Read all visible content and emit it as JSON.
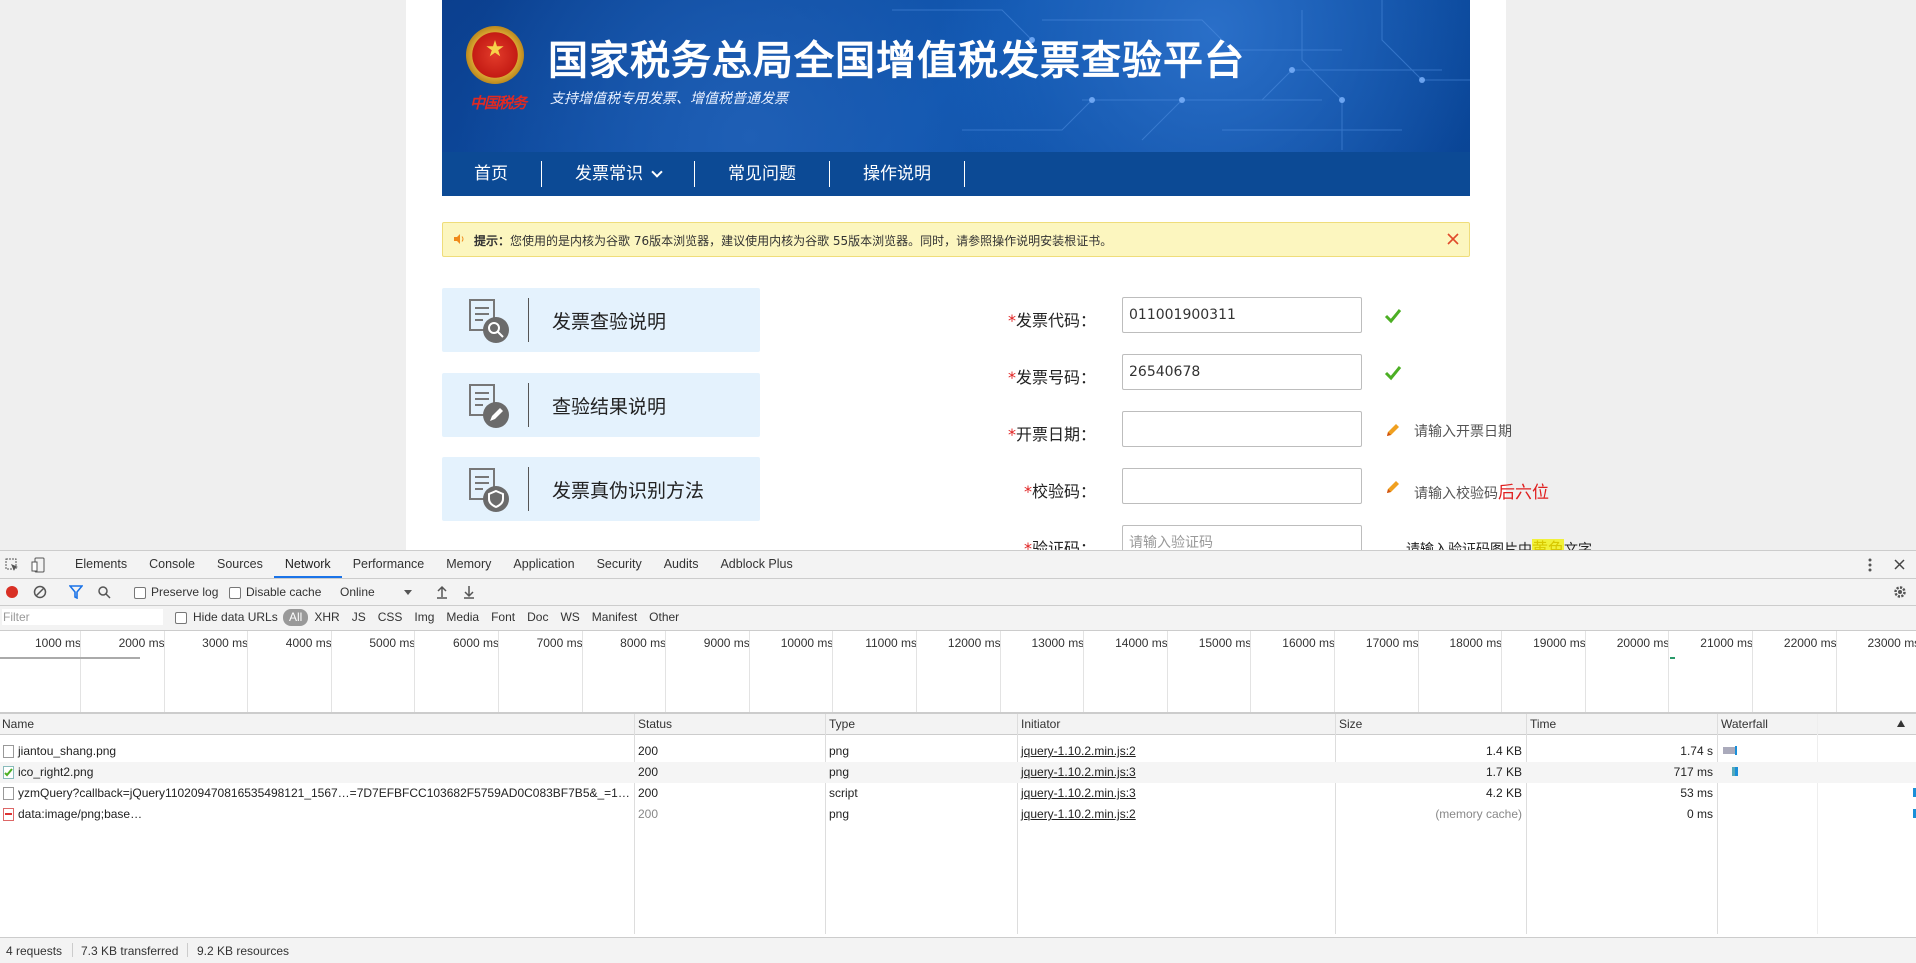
{
  "site": {
    "brand_mark": "中国税务",
    "title": "国家税务总局全国增值税发票查验平台",
    "subtitle": "支持增值税专用发票、增值税普通发票"
  },
  "nav": {
    "items": [
      {
        "label": "首页"
      },
      {
        "label": "发票常识"
      },
      {
        "label": "常见问题"
      },
      {
        "label": "操作说明"
      }
    ]
  },
  "notice": {
    "prefix": "提示：",
    "text": "您使用的是内核为谷歌 76版本浏览器，建议使用内核为谷歌 55版本浏览器。同时，请参照操作说明安装根证书。"
  },
  "side_cards": [
    {
      "label": "发票查验说明",
      "icon": "search-document-icon"
    },
    {
      "label": "查验结果说明",
      "icon": "edit-document-icon"
    },
    {
      "label": "发票真伪识别方法",
      "icon": "shield-document-icon"
    }
  ],
  "form": {
    "required_mark": "*",
    "fields": [
      {
        "label": "发票代码：",
        "value": "011001900311",
        "placeholder": "",
        "status": "valid"
      },
      {
        "label": "发票号码：",
        "value": "26540678",
        "placeholder": "",
        "status": "valid"
      },
      {
        "label": "开票日期：",
        "value": "",
        "placeholder": "",
        "status": "edit",
        "hint": "请输入开票日期"
      },
      {
        "label": "校验码：",
        "value": "",
        "placeholder": "",
        "status": "edit",
        "hint": "请输入校验码",
        "hint_emph": "后六位"
      },
      {
        "label": "验证码：",
        "value": "",
        "placeholder": "请输入验证码",
        "hint_pre": "请输入验证码图片中",
        "hint_yellow": "黄色",
        "hint_post": "文字"
      }
    ]
  },
  "devtools": {
    "tabs": [
      "Elements",
      "Console",
      "Sources",
      "Network",
      "Performance",
      "Memory",
      "Application",
      "Security",
      "Audits",
      "Adblock Plus"
    ],
    "active_tab": "Network",
    "toolbar": {
      "preserve_log": "Preserve log",
      "disable_cache": "Disable cache",
      "throttle": "Online"
    },
    "filter": {
      "placeholder": "Filter",
      "hide_data_urls": "Hide data URLs",
      "types": [
        "All",
        "XHR",
        "JS",
        "CSS",
        "Img",
        "Media",
        "Font",
        "Doc",
        "WS",
        "Manifest",
        "Other"
      ]
    },
    "timeline_ticks": [
      "1000 ms",
      "2000 ms",
      "3000 ms",
      "4000 ms",
      "5000 ms",
      "6000 ms",
      "7000 ms",
      "8000 ms",
      "9000 ms",
      "10000 ms",
      "11000 ms",
      "12000 ms",
      "13000 ms",
      "14000 ms",
      "15000 ms",
      "16000 ms",
      "17000 ms",
      "18000 ms",
      "19000 ms",
      "20000 ms",
      "21000 ms",
      "22000 ms",
      "23000 ms"
    ],
    "columns": [
      "Name",
      "Status",
      "Type",
      "Initiator",
      "Size",
      "Time",
      "Waterfall"
    ],
    "requests": [
      {
        "name": "jiantou_shang.png",
        "status": "200",
        "type": "png",
        "initiator": "jquery-1.10.2.min.js:2",
        "size": "1.4 KB",
        "time": "1.74 s"
      },
      {
        "name": "ico_right2.png",
        "status": "200",
        "type": "png",
        "initiator": "jquery-1.10.2.min.js:3",
        "size": "1.7 KB",
        "time": "717 ms"
      },
      {
        "name": "yzmQuery?callback=jQuery110209470816535498121_1567…=7D7EFBFCC103682F5759AD0C083BF7B5&_=1…",
        "status": "200",
        "type": "script",
        "initiator": "jquery-1.10.2.min.js:3",
        "size": "4.2 KB",
        "time": "53 ms"
      },
      {
        "name": "data:image/png;base…",
        "status": "200",
        "type": "png",
        "initiator": "jquery-1.10.2.min.js:2",
        "size": "(memory cache)",
        "time": "0 ms"
      }
    ],
    "status_bar": {
      "requests": "4 requests",
      "transferred": "7.3 KB transferred",
      "resources": "9.2 KB resources"
    }
  }
}
